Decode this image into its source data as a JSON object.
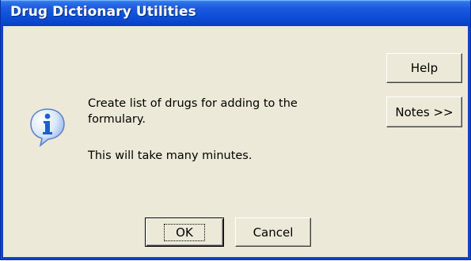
{
  "window": {
    "title": "Drug Dictionary Utilities"
  },
  "icon": "information-icon",
  "message": {
    "line1": "Create list of drugs for adding to the formulary.",
    "line2": "This will take many minutes."
  },
  "buttons": {
    "help": "Help",
    "notes": "Notes >>",
    "ok": "OK",
    "cancel": "Cancel"
  },
  "colors": {
    "titlebar": "#0a46cc",
    "dialog_background": "#ece9d8",
    "info_icon": "#2f6fd6"
  }
}
